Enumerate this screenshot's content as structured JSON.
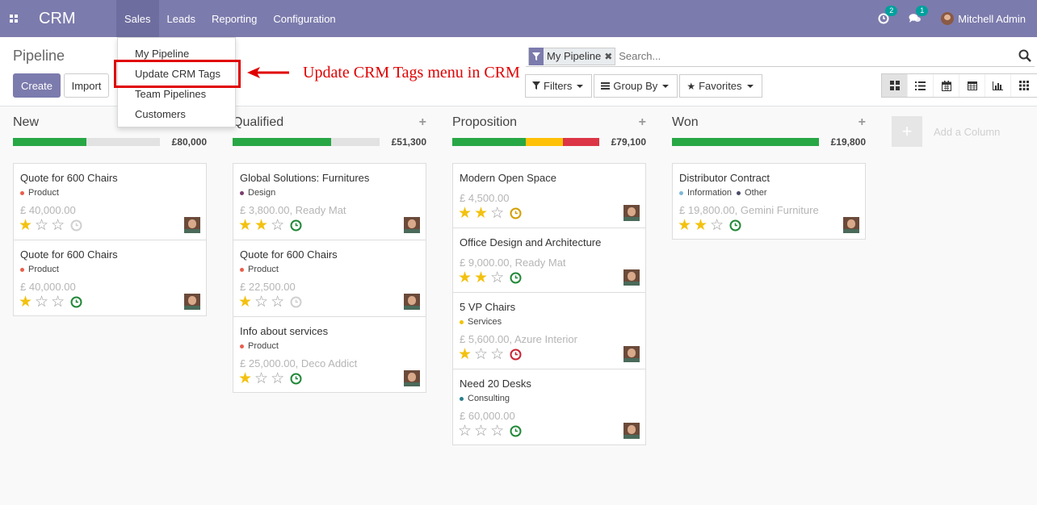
{
  "navbar": {
    "brand": "CRM",
    "menu": [
      {
        "label": "Sales"
      },
      {
        "label": "Leads"
      },
      {
        "label": "Reporting"
      },
      {
        "label": "Configuration"
      }
    ],
    "activities_count": "2",
    "messages_count": "1",
    "user_name": "Mitchell Admin",
    "color": "#7c7bad"
  },
  "sales_menu": {
    "items": [
      "My Pipeline",
      "Update CRM Tags",
      "Team Pipelines",
      "Customers"
    ]
  },
  "annotation": {
    "text": "Update CRM Tags menu in CRM",
    "color": "#e00000"
  },
  "control_panel": {
    "title": "Pipeline",
    "create_label": "Create",
    "import_label": "Import",
    "search": {
      "facet_label": "My Pipeline",
      "placeholder": "Search..."
    },
    "filters_label": "Filters",
    "groupby_label": "Group By",
    "favorites_label": "Favorites",
    "views": [
      "kanban-icon",
      "list-icon",
      "calendar-icon",
      "pivot-icon",
      "graph-icon",
      "activity-icon"
    ]
  },
  "columns": [
    {
      "name": "New",
      "total": "£80,000",
      "progress": [
        {
          "color": "#28a745",
          "fraction": 0.5
        }
      ],
      "cards": [
        {
          "title": "Quote for 600 Chairs",
          "tags": [
            {
              "name": "Product",
              "color": "#e8604c"
            }
          ],
          "amount": "£ 40,000.00",
          "stars": 1,
          "activity": "#d0d0d0"
        },
        {
          "title": "Quote for 600 Chairs",
          "tags": [
            {
              "name": "Product",
              "color": "#e8604c"
            }
          ],
          "amount": "£ 40,000.00",
          "stars": 1,
          "activity": "#218838"
        }
      ]
    },
    {
      "name": "Qualified",
      "total": "£51,300",
      "progress": [
        {
          "color": "#28a745",
          "fraction": 0.67
        }
      ],
      "cards": [
        {
          "title": "Global Solutions: Furnitures",
          "tags": [
            {
              "name": "Design",
              "color": "#7b3d6e"
            }
          ],
          "amount": "£ 3,800.00, Ready Mat",
          "stars": 2,
          "activity": "#218838"
        },
        {
          "title": "Quote for 600 Chairs",
          "tags": [
            {
              "name": "Product",
              "color": "#e8604c"
            }
          ],
          "amount": "£ 22,500.00",
          "stars": 1,
          "activity": "#d0d0d0"
        },
        {
          "title": "Info about services",
          "tags": [
            {
              "name": "Product",
              "color": "#e8604c"
            }
          ],
          "amount": "£ 25,000.00, Deco Addict",
          "stars": 1,
          "activity": "#218838"
        }
      ]
    },
    {
      "name": "Proposition",
      "total": "£79,100",
      "progress": [
        {
          "color": "#28a745",
          "fraction": 0.5
        },
        {
          "color": "#ffc107",
          "fraction": 0.25
        },
        {
          "color": "#dc3545",
          "fraction": 0.25
        }
      ],
      "cards": [
        {
          "title": "Modern Open Space",
          "tags": [],
          "amount": "£ 4,500.00",
          "stars": 2,
          "activity": "#d39e00"
        },
        {
          "title": "Office Design and Architecture",
          "tags": [],
          "amount": "£ 9,000.00, Ready Mat",
          "stars": 2,
          "activity": "#218838"
        },
        {
          "title": "5 VP Chairs",
          "tags": [
            {
              "name": "Services",
              "color": "#f0c300"
            }
          ],
          "amount": "£ 5,600.00, Azure Interior",
          "stars": 1,
          "activity": "#c82333"
        },
        {
          "title": "Need 20 Desks",
          "tags": [
            {
              "name": "Consulting",
              "color": "#2a7f8c"
            }
          ],
          "amount": "£ 60,000.00",
          "stars": 0,
          "activity": "#218838"
        }
      ]
    },
    {
      "name": "Won",
      "total": "£19,800",
      "progress": [
        {
          "color": "#28a745",
          "fraction": 1.0
        }
      ],
      "cards": [
        {
          "title": "Distributor Contract",
          "tags": [
            {
              "name": "Information",
              "color": "#7fb7d9"
            },
            {
              "name": "Other",
              "color": "#4a4a6a"
            }
          ],
          "amount": "£ 19,800.00, Gemini Furniture",
          "stars": 2,
          "activity": "#218838"
        }
      ]
    }
  ],
  "add_column_label": "Add a Column"
}
